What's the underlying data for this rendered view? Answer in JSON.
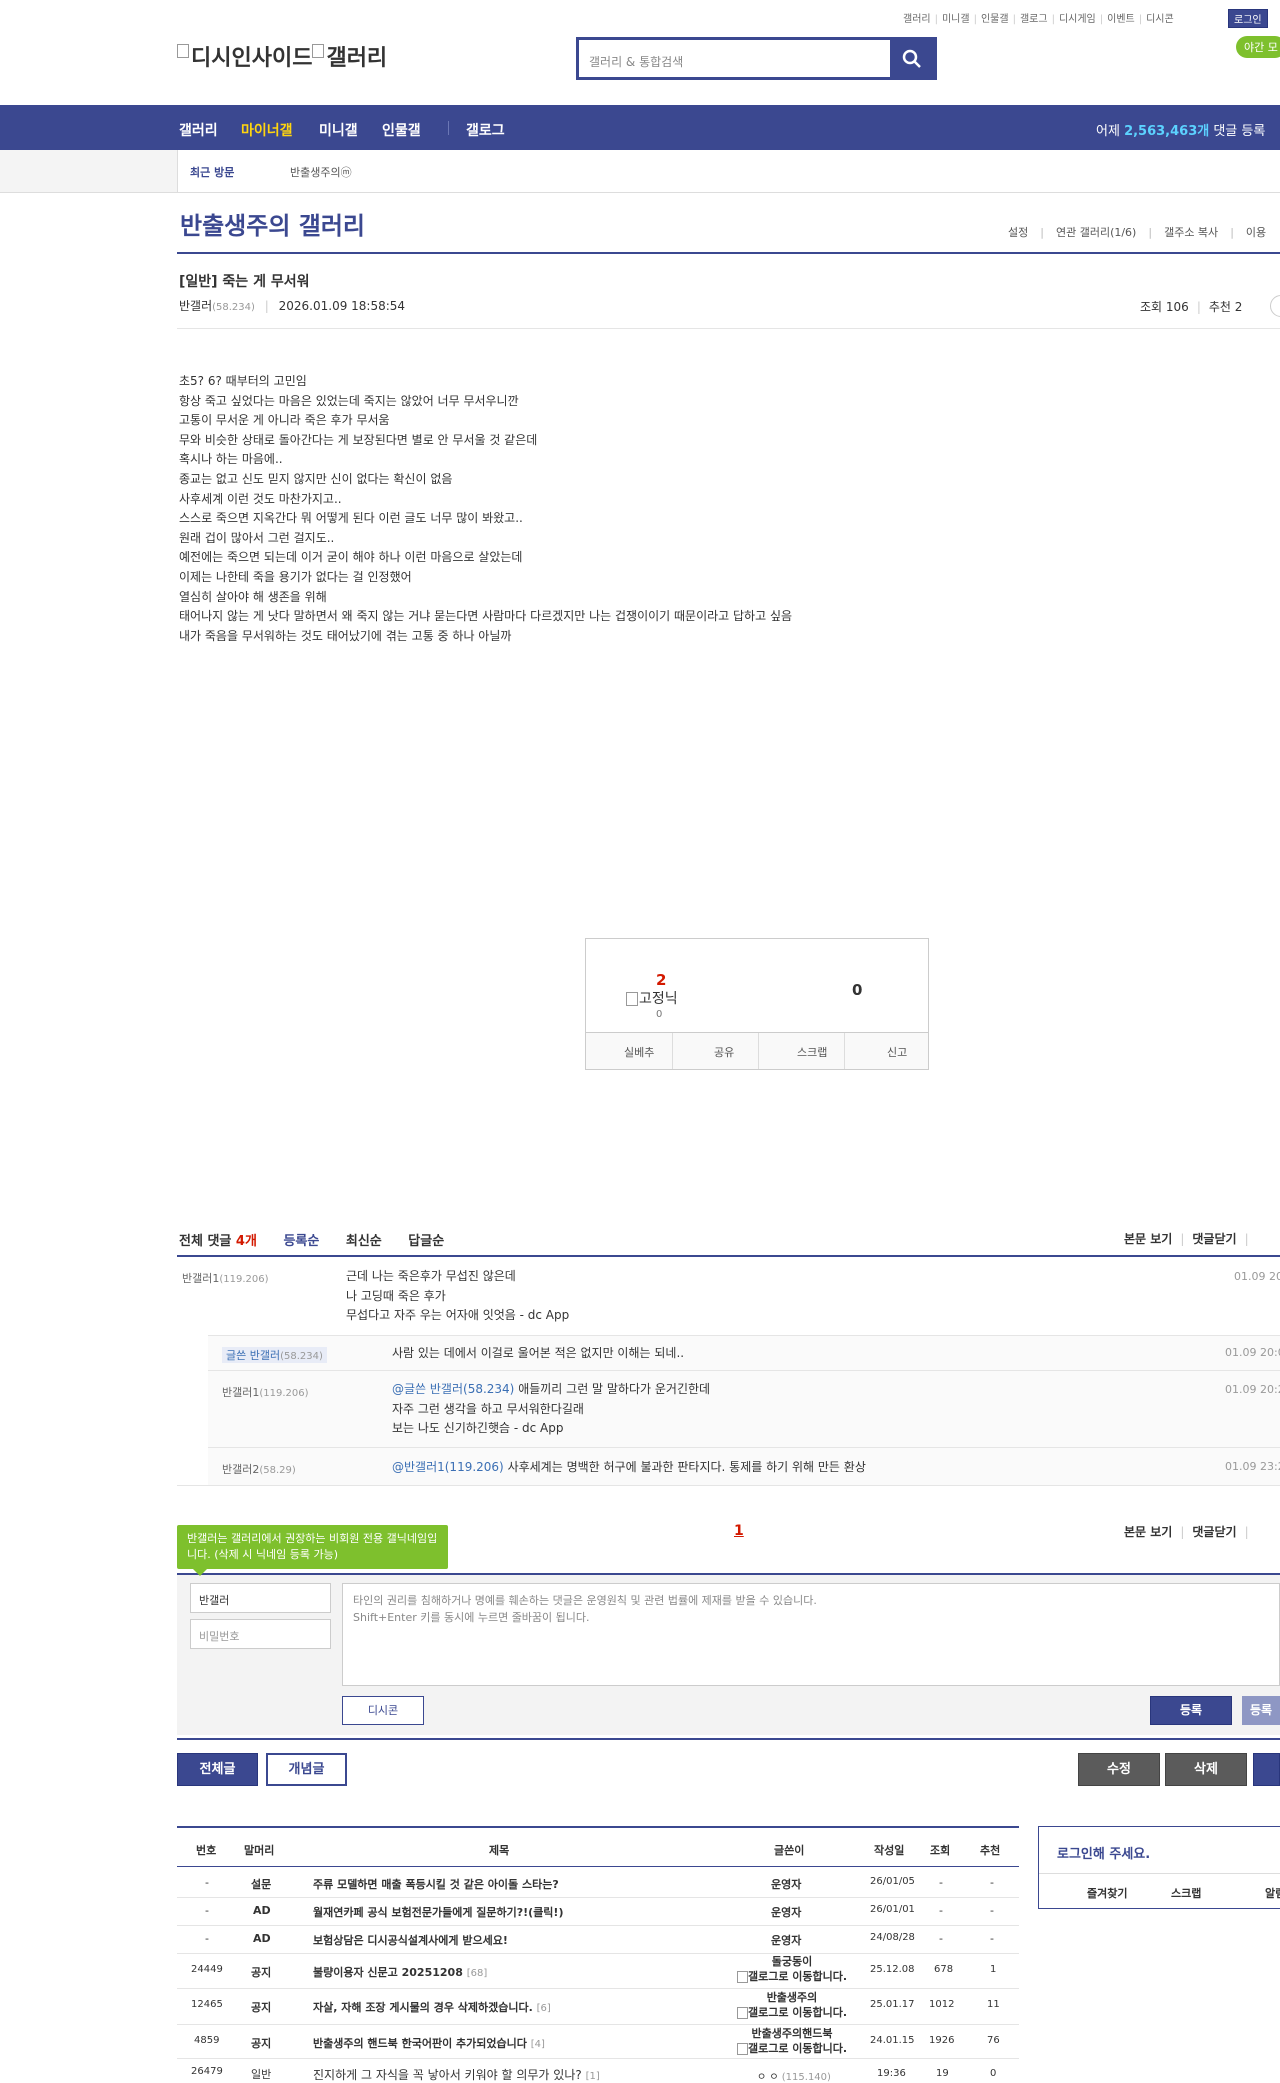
{
  "top": {
    "util_links": [
      "갤러리",
      "미니갤",
      "인물갤",
      "갤로그",
      "디시게임",
      "이벤트",
      "디시콘"
    ],
    "login": "로그인",
    "night_mode": "야간 모",
    "logo_text": "디시인사이드",
    "logo_sub": "갤러리",
    "search_placeholder": "갤러리 & 통합검색"
  },
  "nav": {
    "items": [
      "갤러리",
      "마이너갤",
      "미니갤",
      "인물갤",
      "갤로그"
    ],
    "active_index": 1,
    "stat_prefix": "어제 ",
    "stat_value": "2,563,463개",
    "stat_suffix": " 댓글 등록"
  },
  "recent": {
    "label": "최근 방문",
    "item": "반출생주의ⓜ"
  },
  "gallery": {
    "title": "반출생주의 갤러리",
    "menu": [
      "설정",
      "연관 갤러리(1/6)",
      "갤주소 복사",
      "이용"
    ]
  },
  "post": {
    "title": "[일반] 죽는 게 무서워",
    "author": "반갤러",
    "author_ip": "(58.234)",
    "date": "2026.01.09 18:58:54",
    "views": "조회 106",
    "recommend": "추천 2",
    "body": [
      "초5? 6? 때부터의 고민임",
      "항상 죽고 싶었다는 마음은 있었는데 죽지는 않았어 너무 무서우니깐",
      "고통이 무서운 게 아니라 죽은 후가 무서움",
      "무와 비슷한 상태로 돌아간다는 게 보장된다면 별로 안 무서울 것 같은데",
      "혹시나 하는 마음에..",
      "종교는 없고 신도 믿지 않지만 신이 없다는 확신이 없음",
      "사후세계 이런 것도 마찬가지고..",
      "스스로 죽으면 지옥간다 뭐 어떻게 된다 이런 글도 너무 많이 봐왔고..",
      "원래 겁이 많아서 그런 걸지도..",
      "예전에는 죽으면 되는데 이거 굳이 해야 하나 이런 마음으로 살았는데",
      "이제는 나한테 죽을 용기가 없다는 걸 인정했어",
      "열심히 살아야 해 생존을 위해",
      "태어나지 않는 게 낫다 말하면서 왜 죽지 않는 거냐 묻는다면 사람마다 다르겠지만 나는 겁쟁이이기 때문이라고 답하고 싶음",
      "내가 죽음을 무서워하는 것도 태어났기에 겪는 고통 중 하나 아닐까"
    ]
  },
  "recommend_box": {
    "up": "2",
    "fixed_label": "고정닉",
    "fixed_count": "0",
    "down": "0",
    "buttons": [
      "실베추",
      "공유",
      "스크랩",
      "신고"
    ]
  },
  "comments": {
    "header_label": "전체 댓글 ",
    "count": "4개",
    "sorts": [
      "등록순",
      "최신순",
      "답글순"
    ],
    "view_body": "본문 보기",
    "close": "댓글닫기",
    "list": [
      {
        "nick": "반갤러1",
        "ip": "(119.206)",
        "date": "01.09 20:",
        "lines": [
          "근데 나는 죽은후가 무섭진 않은데",
          "나 고딩때 죽은 후가",
          "무섭다고 자주 우는 어자애 잇엇음 - dc App"
        ]
      },
      {
        "nick": "글쓴 반갤러",
        "ip": "(58.234)",
        "date": "01.09 20:0",
        "lines": [
          "사람 있는 데에서 이걸로 울어본 적은 없지만 이해는 되네.."
        ]
      },
      {
        "nick": "반갤러1",
        "ip": "(119.206)",
        "date": "01.09 20:2",
        "mention": "@글쓴 반갤러(58.234)",
        "lines": [
          " 애들끼리 그런 말 말하다가 운거긴한데",
          "자주 그런 생각을 하고 무서워한다길래",
          "보는 나도 신기하긴햇슴 - dc App"
        ]
      },
      {
        "nick": "반갤러2",
        "ip": "(58.29)",
        "date": "01.09 23:2",
        "mention": "@반갤러1(119.206)",
        "lines": [
          " 사후세계는 명백한 허구에 불과한 판타지다. 통제를 하기 위해 만든 환상"
        ]
      }
    ],
    "page": "1"
  },
  "write": {
    "tip": "반갤러는 갤러리에서 권장하는 비회원 전용 갤닉네임입니다. (삭제 시 닉네임 등록 가능)",
    "nick_value": "반갤러",
    "password_placeholder": "비밀번호",
    "textarea_line1": "타인의 권리를 침해하거나 명예를 훼손하는 댓글은 운영원칙 및 관련 법률에 제재를 받을 수 있습니다.",
    "textarea_line2": "Shift+Enter 키를 동시에 누르면 줄바꿈이 됩니다.",
    "dccon": "디시콘",
    "submit": "등록",
    "submit2": "등록"
  },
  "actions": {
    "all": "전체글",
    "concept": "개념글",
    "edit": "수정",
    "delete": "삭제"
  },
  "list": {
    "headers": [
      "번호",
      "말머리",
      "제목",
      "글쓴이",
      "작성일",
      "조회",
      "추천"
    ],
    "rows": [
      {
        "no": "-",
        "head": "설문",
        "title": "주류 모델하면 매출 폭등시킬 것 같은 아이돌 스타는?",
        "cnt": "",
        "writer": "운영자",
        "date": "26/01/05",
        "views": "-",
        "rec": "-"
      },
      {
        "no": "-",
        "head": "AD",
        "title": "월재연카페 공식 보험전문가들에게 질문하기?!(클릭!)",
        "cnt": "",
        "writer": "운영자",
        "date": "26/01/01",
        "views": "-",
        "rec": "-"
      },
      {
        "no": "-",
        "head": "AD",
        "title": "보험상담은 디시공식설계사에게 받으세요!",
        "cnt": "",
        "writer": "운영자",
        "date": "24/08/28",
        "views": "-",
        "rec": "-"
      },
      {
        "no": "24449",
        "head": "공지",
        "title": "불량이용자 신문고 20251208",
        "cnt": "[68]",
        "writer": "돌궁동이",
        "writer2": "갤로그로 이동합니다.",
        "date": "25.12.08",
        "views": "678",
        "rec": "1"
      },
      {
        "no": "12465",
        "head": "공지",
        "title": "자살, 자해 조장 게시물의 경우 삭제하겠습니다.",
        "cnt": "[6]",
        "writer": "반출생주의",
        "writer2": "갤로그로 이동합니다.",
        "date": "25.01.17",
        "views": "1012",
        "rec": "11"
      },
      {
        "no": "4859",
        "head": "공지",
        "title": "반출생주의 핸드북 한국어판이 추가되었습니다",
        "cnt": "[4]",
        "writer": "반출생주의핸드북",
        "writer2": "갤로그로 이동합니다.",
        "date": "24.01.15",
        "views": "1926",
        "rec": "76"
      },
      {
        "no": "26479",
        "head": "일반",
        "title": "진지하게 그 자식을 꼭 낳아서 키워야 할 의무가 있나?",
        "cnt": "[1]",
        "writer": "ㅇ ㅇ",
        "writer_ip": "(115.140)",
        "date": "19:36",
        "views": "19",
        "rec": "0"
      }
    ]
  },
  "side": {
    "title": "로그인해 주세요.",
    "links": [
      "즐겨찾기",
      "스크랩",
      "알림"
    ]
  }
}
